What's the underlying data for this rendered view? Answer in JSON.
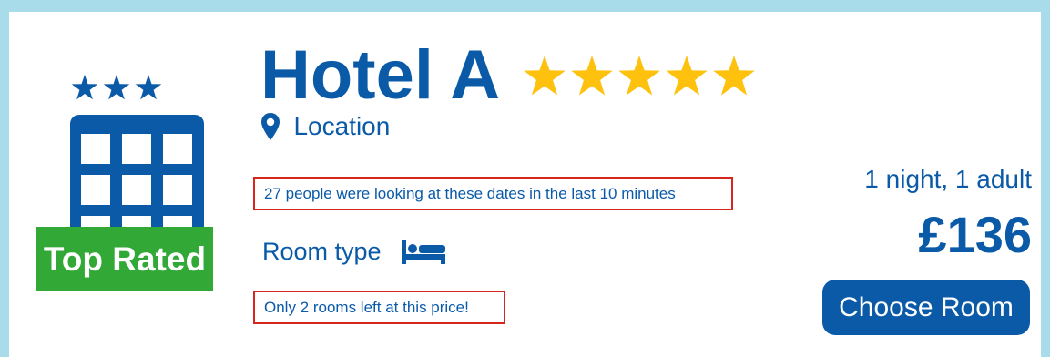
{
  "hotel": {
    "name": "Hotel A",
    "rating_stars": 5,
    "badge": "Top Rated",
    "location_label": "Location",
    "room_type_label": "Room type"
  },
  "notices": {
    "recent_views": "27 people were looking at these dates in the last 10 minutes",
    "rooms_left": "Only 2 rooms left at this price!"
  },
  "pricing": {
    "stay_summary": "1 night, 1 adult",
    "price": "£136",
    "choose_button": "Choose Room"
  },
  "icons": {
    "logo": "hotel-building-icon",
    "location": "map-pin-icon",
    "room_type": "bed-icon",
    "rating": "star-icon"
  },
  "colors": {
    "background": "#a8dcea",
    "brand_blue": "#0a5aa8",
    "star_gold": "#fec10e",
    "badge_green": "#32a837",
    "notice_border": "#d7261e"
  }
}
